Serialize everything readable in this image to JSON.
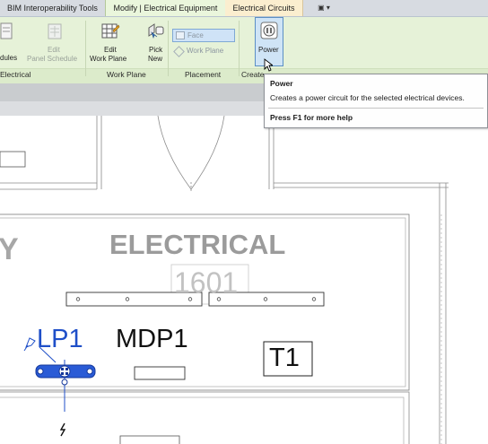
{
  "tabs": [
    {
      "label": "BIM Interoperability Tools"
    },
    {
      "label": "Modify | Electrical Equipment"
    },
    {
      "label": "Electrical Circuits"
    }
  ],
  "tab_switcher_icon": "panel-toggle-icon",
  "ribbon": {
    "buttons": {
      "schedules": "dules",
      "edit_panel_schedule_1": "Edit",
      "edit_panel_schedule_2": "Panel Schedule",
      "edit_work_plane_1": "Edit",
      "edit_work_plane_2": "Work Plane",
      "pick_new_1": "Pick",
      "pick_new_2": "New",
      "face": "Face",
      "work_plane": "Work Plane",
      "power": "Power"
    },
    "groups": {
      "electrical": "Electrical",
      "work_plane": "Work Plane",
      "placement": "Placement",
      "create": "Create"
    }
  },
  "tooltip": {
    "title": "Power",
    "description": "Creates a power circuit for the selected electrical devices.",
    "help": "Press F1 for more help"
  },
  "drawing": {
    "room_name": "ELECTRICAL",
    "room_name_partial": "Y",
    "room_number": "1601",
    "panel_selected": "LP1",
    "panel_main": "MDP1",
    "transformer": "T1"
  },
  "colors": {
    "selection_blue": "#1f4fc8",
    "ribbon_green": "#e6f2d8",
    "tooltip_border": "#8d9096"
  }
}
